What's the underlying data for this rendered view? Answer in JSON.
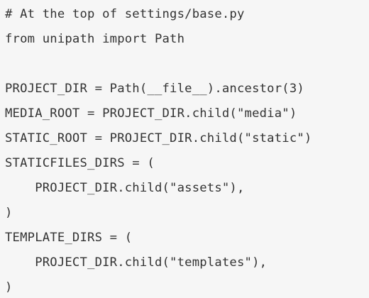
{
  "code": {
    "lines": [
      "# At the top of settings/base.py",
      "from unipath import Path",
      "",
      "PROJECT_DIR = Path(__file__).ancestor(3)",
      "MEDIA_ROOT = PROJECT_DIR.child(\"media\")",
      "STATIC_ROOT = PROJECT_DIR.child(\"static\")",
      "STATICFILES_DIRS = (",
      "    PROJECT_DIR.child(\"assets\"),",
      ")",
      "TEMPLATE_DIRS = (",
      "    PROJECT_DIR.child(\"templates\"),",
      ")"
    ]
  }
}
